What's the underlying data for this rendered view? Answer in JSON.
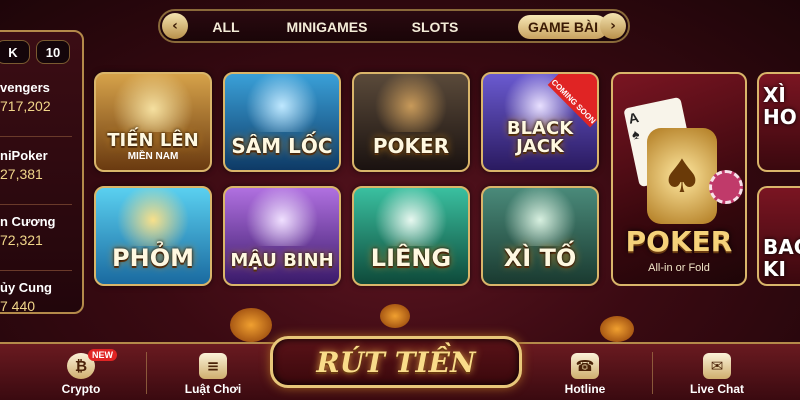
{
  "nav": {
    "prev": "‹",
    "next": "›",
    "tabs": [
      {
        "label": "ALL"
      },
      {
        "label": "MINIGAMES"
      },
      {
        "label": "SLOTS"
      },
      {
        "label": "GAME BÀI"
      }
    ],
    "active_tab": "GAME BÀI"
  },
  "leaderboard": {
    "header_left": "K",
    "header_right": "10",
    "rows": [
      {
        "name": "vengers",
        "amount": "717,202"
      },
      {
        "name": "niPoker",
        "amount": "27,381"
      },
      {
        "name": "n Cương",
        "amount": "72,321"
      },
      {
        "name": "ủy Cung",
        "amount": "7 440"
      }
    ]
  },
  "games": [
    {
      "title": "TIẾN LÊN",
      "subtitle": "MIỀN NAM",
      "color": "#8a5a18"
    },
    {
      "title": "SÂM LỐC",
      "subtitle": "",
      "color": "#1f5a8a"
    },
    {
      "title": "POKER",
      "subtitle": "",
      "color": "#2a2a2a"
    },
    {
      "title": "BLACK JACK",
      "subtitle": "",
      "color": "#3a2a7a",
      "badge": "COMING SOON"
    },
    {
      "title": "PHỎM",
      "subtitle": "",
      "color": "#2a7aa8"
    },
    {
      "title": "MẬU BINH",
      "subtitle": "",
      "color": "#5a2a8a"
    },
    {
      "title": "LIÊNG",
      "subtitle": "",
      "color": "#1f6a5a"
    },
    {
      "title": "XÌ TỐ",
      "subtitle": "",
      "color": "#2a5a4a"
    }
  ],
  "featured": {
    "title": "POKER",
    "subtitle": "All-in or Fold"
  },
  "right_partial": [
    {
      "title": "XÌ HO"
    },
    {
      "title": "BAC KI"
    }
  ],
  "bottom": {
    "items": [
      {
        "label": "Crypto",
        "icon": "₿",
        "icon_name": "bitcoin-icon"
      },
      {
        "label": "Luật Chơi",
        "icon": "≡",
        "icon_name": "rules-book-icon"
      },
      {
        "label": "Hotline",
        "icon": "☎",
        "icon_name": "phone-icon"
      },
      {
        "label": "Live Chat",
        "icon": "✉",
        "icon_name": "chat-icon"
      }
    ],
    "new_badge": "NEW",
    "withdraw": "RÚT TIỀN"
  }
}
